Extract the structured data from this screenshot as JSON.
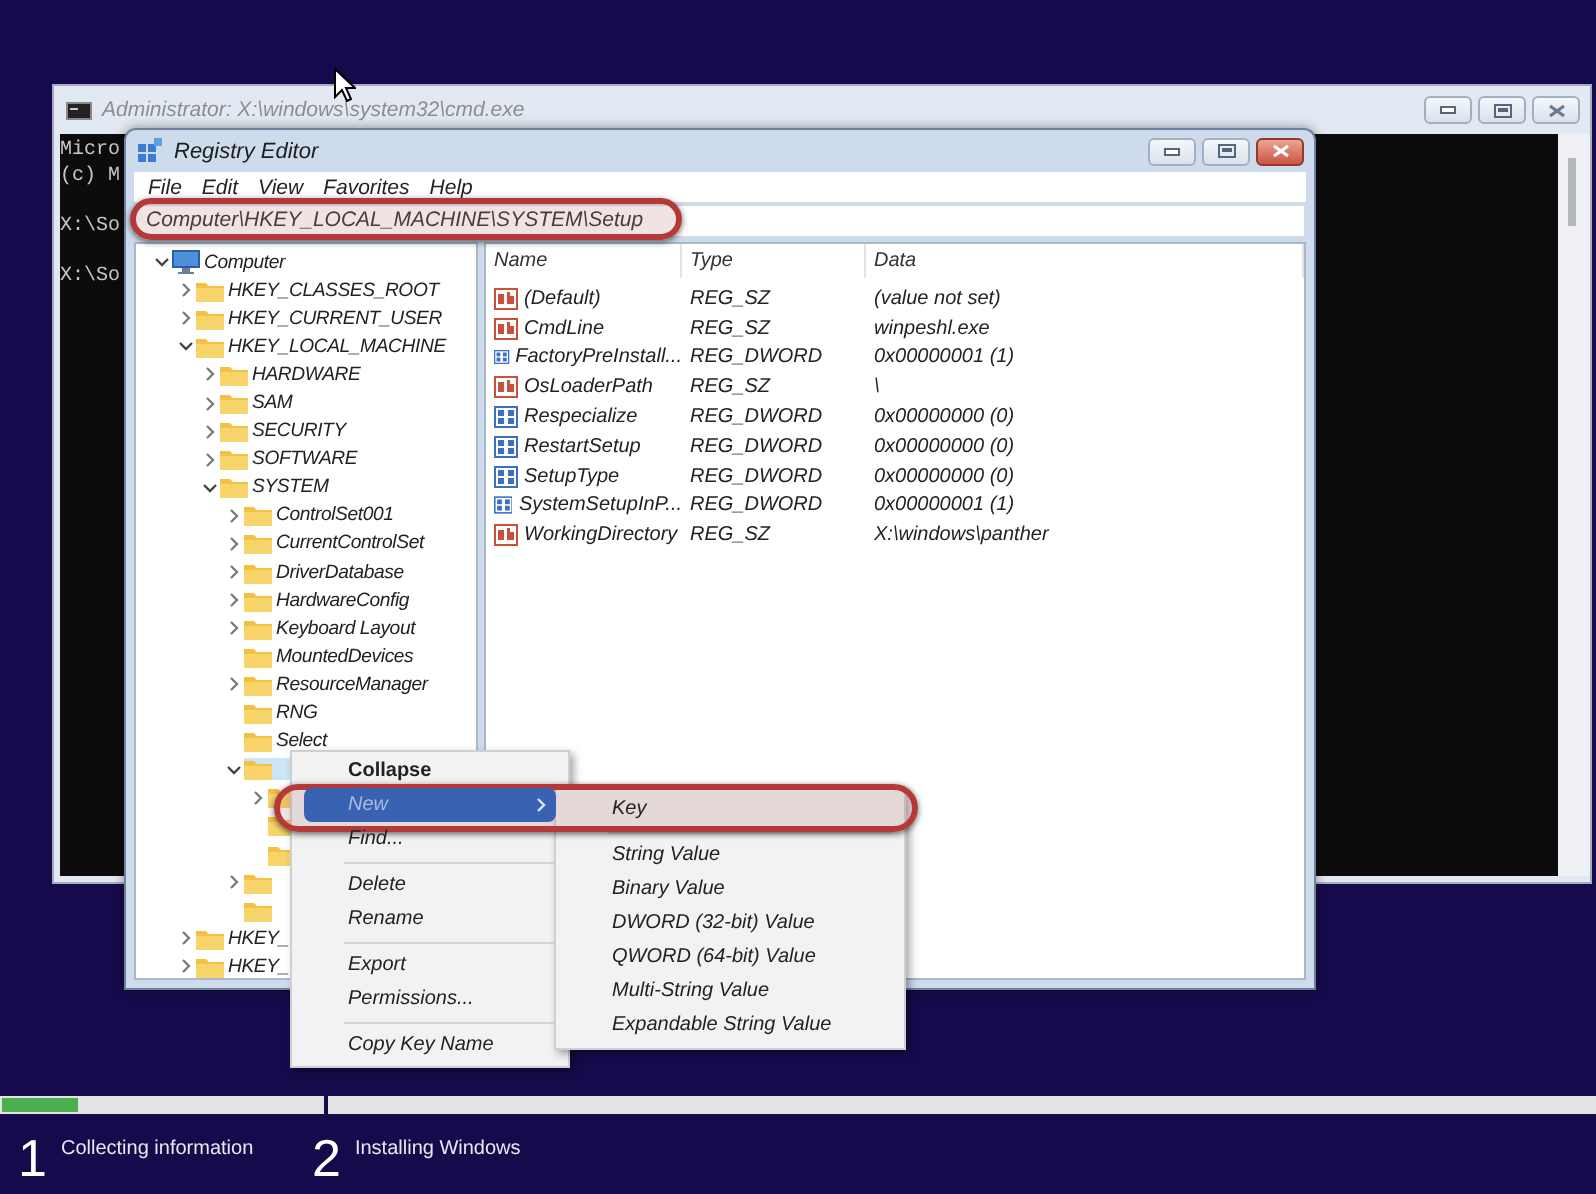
{
  "console_window": {
    "title": "Administrator: X:\\windows\\system32\\cmd.exe",
    "blocks": [
      [
        "Micro",
        "(c) M"
      ],
      [
        "X:\\So"
      ],
      [
        "X:\\So"
      ]
    ]
  },
  "registry_editor": {
    "title": "Registry Editor",
    "menu": [
      "File",
      "Edit",
      "View",
      "Favorites",
      "Help"
    ],
    "address": "Computer\\HKEY_LOCAL_MACHINE\\SYSTEM\\Setup",
    "tree": [
      {
        "label": "Computer",
        "kind": "computer",
        "expanded": true,
        "selected": false,
        "children": [
          {
            "label": "HKEY_CLASSES_ROOT",
            "expanded": false,
            "selected": false
          },
          {
            "label": "HKEY_CURRENT_USER",
            "expanded": false,
            "selected": false
          },
          {
            "label": "HKEY_LOCAL_MACHINE",
            "expanded": true,
            "selected": false,
            "children": [
              {
                "label": "HARDWARE",
                "expanded": false,
                "selected": false
              },
              {
                "label": "SAM",
                "expanded": false,
                "selected": false
              },
              {
                "label": "SECURITY",
                "expanded": false,
                "selected": false
              },
              {
                "label": "SOFTWARE",
                "expanded": false,
                "selected": false
              },
              {
                "label": "SYSTEM",
                "expanded": true,
                "selected": false,
                "children": [
                  {
                    "label": "ControlSet001",
                    "expanded": false,
                    "selected": false
                  },
                  {
                    "label": "CurrentControlSet",
                    "expanded": false,
                    "selected": false
                  },
                  {
                    "label": "DriverDatabase",
                    "expanded": false,
                    "selected": false
                  },
                  {
                    "label": "HardwareConfig",
                    "expanded": false,
                    "selected": false
                  },
                  {
                    "label": "Keyboard Layout",
                    "expanded": false,
                    "selected": false
                  },
                  {
                    "label": "MountedDevices",
                    "selected": false
                  },
                  {
                    "label": "ResourceManager",
                    "expanded": false,
                    "selected": false
                  },
                  {
                    "label": "RNG",
                    "selected": false
                  },
                  {
                    "label": "Select",
                    "selected": false
                  },
                  {
                    "expanded": true,
                    "selected": true,
                    "children": [
                      {
                        "expanded": false,
                        "selected": false
                      },
                      {
                        "selected": false
                      },
                      {
                        "selected": false
                      }
                    ]
                  },
                  {
                    "expanded": false,
                    "selected": false
                  },
                  {
                    "selected": false
                  }
                ]
              }
            ]
          },
          {
            "label": "HKEY_",
            "expanded": false,
            "selected": false
          },
          {
            "label": "HKEY_",
            "expanded": false,
            "selected": false
          }
        ]
      }
    ],
    "columns": [
      "Name",
      "Type",
      "Data"
    ],
    "values": [
      {
        "kind": "string",
        "name": "(Default)",
        "type": "REG_SZ",
        "data": "(value not set)"
      },
      {
        "kind": "string",
        "name": "CmdLine",
        "type": "REG_SZ",
        "data": "winpeshl.exe"
      },
      {
        "kind": "binary",
        "name": "FactoryPreInstall...",
        "type": "REG_DWORD",
        "data": "0x00000001 (1)"
      },
      {
        "kind": "string",
        "name": "OsLoaderPath",
        "type": "REG_SZ",
        "data": "\\"
      },
      {
        "kind": "binary",
        "name": "Respecialize",
        "type": "REG_DWORD",
        "data": "0x00000000 (0)"
      },
      {
        "kind": "binary",
        "name": "RestartSetup",
        "type": "REG_DWORD",
        "data": "0x00000000 (0)"
      },
      {
        "kind": "binary",
        "name": "SetupType",
        "type": "REG_DWORD",
        "data": "0x00000000 (0)"
      },
      {
        "kind": "binary",
        "name": "SystemSetupInP...",
        "type": "REG_DWORD",
        "data": "0x00000001 (1)"
      },
      {
        "kind": "string",
        "name": "WorkingDirectory",
        "type": "REG_SZ",
        "data": "X:\\windows\\panther"
      }
    ]
  },
  "context_menu": {
    "items": [
      {
        "kind": "item",
        "label": "Collapse",
        "bold": true,
        "selected": false
      },
      {
        "kind": "submenu",
        "label": "New",
        "bold": false,
        "selected": true
      },
      {
        "kind": "item",
        "label": "Find...",
        "bold": false,
        "selected": false
      },
      {
        "kind": "separator"
      },
      {
        "kind": "item",
        "label": "Delete",
        "bold": false,
        "selected": false
      },
      {
        "kind": "item",
        "label": "Rename",
        "bold": false,
        "selected": false
      },
      {
        "kind": "separator"
      },
      {
        "kind": "item",
        "label": "Export",
        "bold": false,
        "selected": false
      },
      {
        "kind": "item",
        "label": "Permissions...",
        "bold": false,
        "selected": false
      },
      {
        "kind": "separator"
      },
      {
        "kind": "item",
        "label": "Copy Key Name",
        "bold": false,
        "selected": false
      }
    ]
  },
  "submenu": {
    "items": [
      {
        "kind": "item",
        "label": "Key"
      },
      {
        "kind": "separator"
      },
      {
        "kind": "item",
        "label": "String Value"
      },
      {
        "kind": "item",
        "label": "Binary Value"
      },
      {
        "kind": "item",
        "label": "DWORD (32-bit) Value"
      },
      {
        "kind": "item",
        "label": "QWORD (64-bit) Value"
      },
      {
        "kind": "item",
        "label": "Multi-String Value"
      },
      {
        "kind": "item",
        "label": "Expandable String Value"
      }
    ]
  },
  "setup_steps": [
    {
      "number": "1",
      "label": "Collecting information",
      "level": 0.24
    },
    {
      "number": "2",
      "label": "Installing Windows",
      "level": 0
    }
  ]
}
